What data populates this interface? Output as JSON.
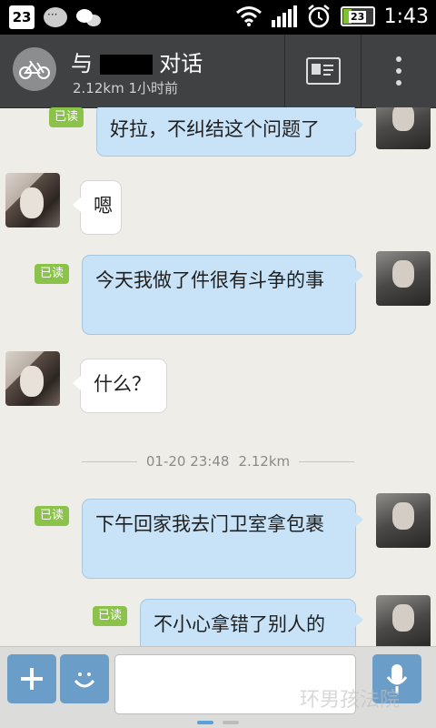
{
  "status_bar": {
    "calendar_day": "23",
    "battery_level": "23",
    "time": "1:43",
    "icons": [
      "calendar-icon",
      "message-icon",
      "wechat-icon",
      "wifi-icon",
      "signal-icon",
      "alarm-icon",
      "battery-icon"
    ]
  },
  "header": {
    "title_prefix": "与",
    "title_suffix": "对话",
    "subtitle": "2.12km 1小时前"
  },
  "read_label": "已读",
  "messages": [
    {
      "side": "out",
      "text": "好拉，不纠结这个问题了",
      "read": true
    },
    {
      "side": "in",
      "text": "嗯"
    },
    {
      "side": "out",
      "text": "今天我做了件很有斗争的事",
      "read": true
    },
    {
      "side": "in",
      "text": "什么？"
    },
    {
      "side": "out",
      "text": "下午回家我去门卫室拿包裹",
      "read": true
    },
    {
      "side": "out",
      "text": "不小心拿错了别人的",
      "read": true
    }
  ],
  "divider": {
    "time": "01-20 23:48",
    "distance": "2.12km"
  },
  "input_bar": {
    "watermark": "环男孩法院"
  },
  "colors": {
    "accent": "#6a9ec9",
    "read_badge": "#8bc34a",
    "outgoing_bubble": "#c8e3f7"
  }
}
